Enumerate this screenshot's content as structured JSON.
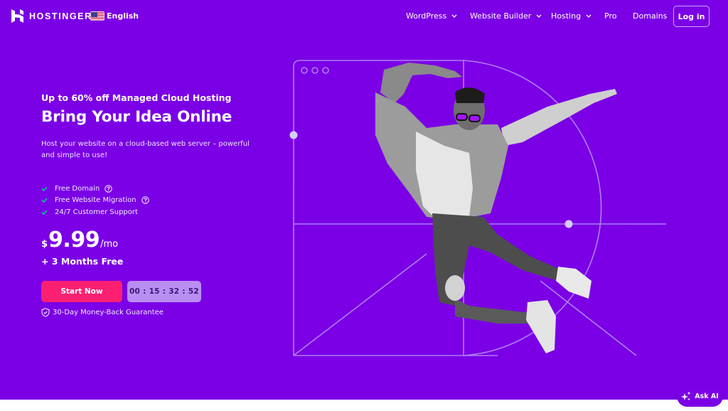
{
  "header": {
    "logo_text": "HOSTINGER",
    "language": {
      "flag_icon": "us-flag-icon",
      "label": "English"
    },
    "nav": [
      {
        "label": "WordPress",
        "has_dropdown": true
      },
      {
        "label": "Website Builder",
        "has_dropdown": true
      },
      {
        "label": "Hosting",
        "has_dropdown": true
      },
      {
        "label": "Pro",
        "has_dropdown": false
      },
      {
        "label": "Domains",
        "has_dropdown": false
      }
    ],
    "login_label": "Log in"
  },
  "hero": {
    "kicker": "Up to 60% off Managed Cloud Hosting",
    "title": "Bring Your Idea Online",
    "description": "Host your website on a cloud-based web server – powerful and simple to use!",
    "features": [
      {
        "label": "Free Domain",
        "has_help": true
      },
      {
        "label": "Free Website Migration",
        "has_help": true
      },
      {
        "label": "24/7 Customer Support",
        "has_help": false
      }
    ],
    "price": {
      "currency": "$",
      "amount": "9.99",
      "period": "/mo"
    },
    "bonus": "+ 3 Months Free",
    "cta_label": "Start Now",
    "countdown": "00 : 15 : 32 : 52",
    "guarantee": "30-Day Money-Back Guarantee"
  },
  "ask_ai": {
    "label": "Ask AI"
  },
  "colors": {
    "brand_purple": "#7b00e6",
    "cta_pink": "#fc1f72",
    "timer_bg": "#b98ef3",
    "check_green": "#00c88c",
    "line_lavender": "#b895f5"
  }
}
